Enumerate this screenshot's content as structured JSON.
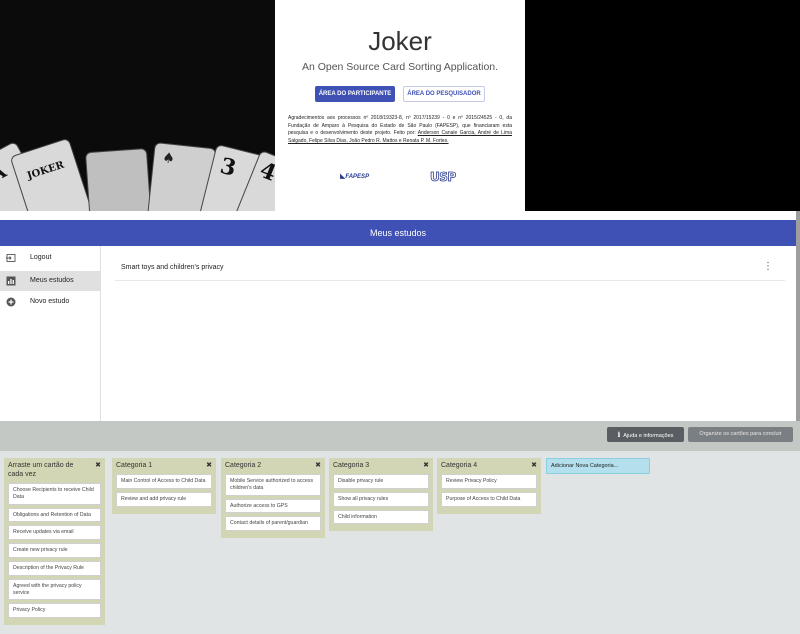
{
  "landing": {
    "title": "Joker",
    "subtitle": "An Open Source Card Sorting Application.",
    "btn_participant": "ÁREA DO PARTICIPANTE",
    "btn_researcher": "ÁREA DO PESQUISADOR",
    "ack_text": "Agradecimentos aos processos nº 2018/19323-8, nº 2017/15239 - 0 e nº 2015/24525 - 0, da Fundação de Amparo à Pesquisa do Estado de São Paulo (FAPESP), que financiaram esta pesquisa e o desenvolvimento deste projeto. Feito por: ",
    "ack_authors": "Anderson Canale Garcia, André de Lima Salgado, Felipe Silva Dias, João Pedro R. Mattos e Renata P. M. Fortes.",
    "logo_fapesp": "FAPESP",
    "logo_usp": "USP",
    "card_texts": [
      "A",
      "JOKER",
      "3",
      "4",
      "4",
      "A"
    ]
  },
  "studies": {
    "header": "Meus estudos",
    "sidebar": [
      {
        "label": "Logout",
        "icon": "logout-icon"
      },
      {
        "label": "Meus estudos",
        "icon": "chart-icon"
      },
      {
        "label": "Novo estudo",
        "icon": "add-circle-icon"
      }
    ],
    "study_name": "Smart toys and children's privacy",
    "menu_glyph": "⋮"
  },
  "sorting": {
    "help_label": "Ajuda e informações",
    "finish_label": "Organize os cartões para concluir",
    "new_category": "Adicionar Nova Categoria...",
    "columns": [
      {
        "title": "Arraste um cartão de cada vez",
        "items": [
          "Choose Recipients to receive Child Data",
          "Obligations and Retention of Data",
          "Receive updates via email",
          "Create new privacy rule",
          "Description of the Privacy Rule",
          "Agreed with the privacy policy service",
          "Privacy Policy"
        ]
      },
      {
        "title": "Categoria 1",
        "items": [
          "Main Control of Access to Child Data",
          "Review and add privacy rule"
        ]
      },
      {
        "title": "Categoria 2",
        "items": [
          "Mobile Service authorized to access children's data",
          "Authorize access to GPS",
          "Contact details of parent/guardian"
        ]
      },
      {
        "title": "Categoria 3",
        "items": [
          "Disable privacy rule",
          "Show all privacy rules",
          "Child information"
        ]
      },
      {
        "title": "Categoria 4",
        "items": [
          "Review Privacy Policy",
          "Purpose of Access to Child Data"
        ]
      }
    ]
  },
  "colors": {
    "accent": "#3f51b5",
    "category_bg": "#d3d6b4",
    "new_category_bg": "#b3e0ec"
  }
}
